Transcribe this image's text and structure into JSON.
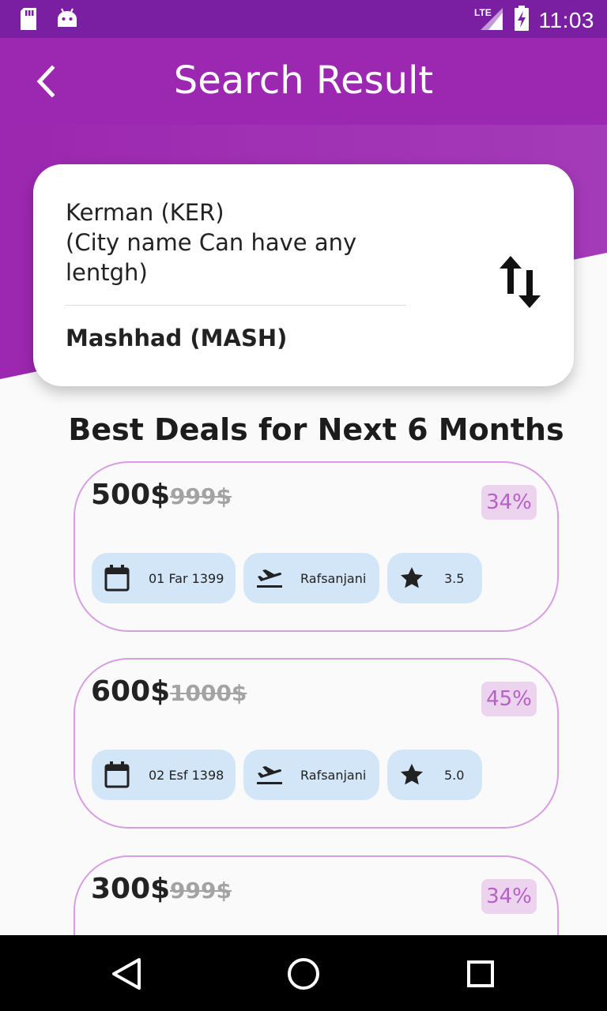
{
  "status_bar": {
    "time": "11:03",
    "network": "LTE",
    "icons": [
      "sd-card-icon",
      "android-icon",
      "lte-signal-icon",
      "battery-charging-icon"
    ]
  },
  "header": {
    "title": "Search Result",
    "back_icon": "chevron-left-icon"
  },
  "route": {
    "origin": "Kerman (KER)\n (City name Can have any lentgh)",
    "destination": "Mashhad (MASH)",
    "swap_icon": "swap-vertical-icon"
  },
  "section_title": "Best Deals for Next 6 Months",
  "deals": [
    {
      "price": "500$",
      "old_price": "999$",
      "discount": "34%",
      "date": "01 Far 1399",
      "airport": "Rafsanjani",
      "rating": "3.5"
    },
    {
      "price": "600$",
      "old_price": "1000$",
      "discount": "45%",
      "date": "02 Esf 1398",
      "airport": "Rafsanjani",
      "rating": "5.0"
    },
    {
      "price": "300$",
      "old_price": "999$",
      "discount": "34%",
      "date": "",
      "airport": "",
      "rating": ""
    }
  ],
  "nav_bar": {
    "icons": [
      "back-triangle-icon",
      "home-circle-icon",
      "recents-square-icon"
    ]
  },
  "colors": {
    "status_bar": "#7a1fa2",
    "header": "#9c27b0",
    "card_border": "#d79ee2",
    "badge_bg": "#ecd3ee",
    "badge_text": "#b561c5",
    "chip_bg": "#d2e6f7"
  }
}
